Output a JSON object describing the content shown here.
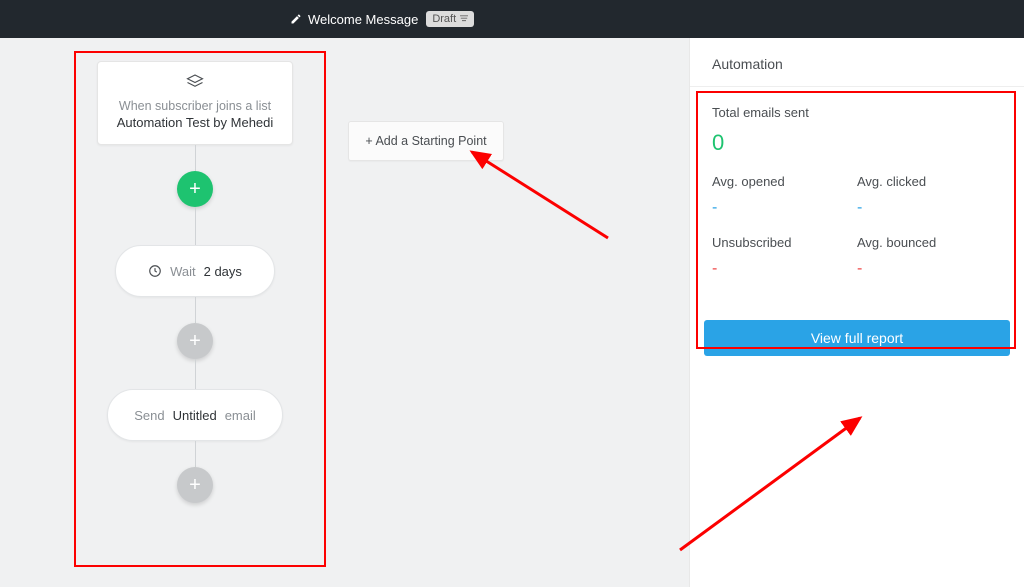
{
  "header": {
    "title": "Welcome Message",
    "badge": "Draft"
  },
  "flow": {
    "trigger": {
      "line1": "When subscriber joins a list",
      "line2": "Automation Test by Mehedi"
    },
    "wait_prefix": "Wait",
    "wait_strong": "2 days",
    "send_prefix": "Send",
    "send_strong": "Untitled",
    "send_suffix": "email",
    "add_start": "+ Add a Starting Point"
  },
  "sidebar": {
    "heading": "Automation",
    "total_label": "Total emails sent",
    "total_value": "0",
    "avg_opened_label": "Avg. opened",
    "avg_opened_value": "-",
    "avg_clicked_label": "Avg. clicked",
    "avg_clicked_value": "-",
    "unsub_label": "Unsubscribed",
    "unsub_value": "-",
    "bounced_label": "Avg. bounced",
    "bounced_value": "-",
    "report_button": "View full report"
  }
}
